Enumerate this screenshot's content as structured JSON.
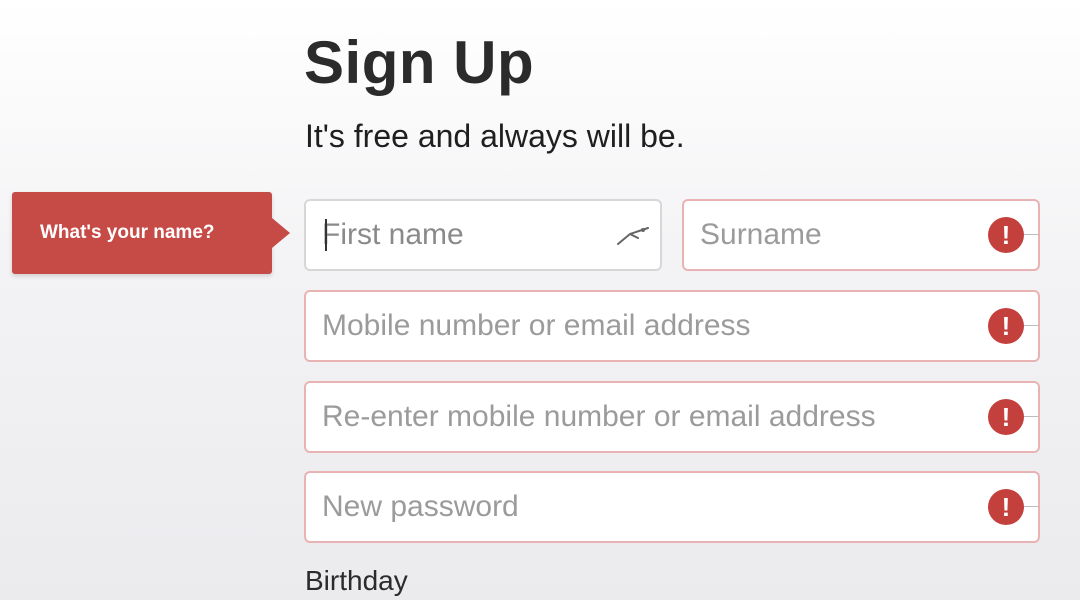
{
  "header": {
    "title": "Sign Up",
    "subtitle": "It's free and always will be."
  },
  "tooltip": {
    "text": "What's your name?"
  },
  "form": {
    "first_name": {
      "placeholder": "First name",
      "value": ""
    },
    "surname": {
      "placeholder": "Surname",
      "value": ""
    },
    "contact": {
      "placeholder": "Mobile number or email address",
      "value": ""
    },
    "contact_confirm": {
      "placeholder": "Re-enter mobile number or email address",
      "value": ""
    },
    "password": {
      "placeholder": "New password",
      "value": ""
    },
    "error_symbol": "!",
    "birthday_label": "Birthday"
  },
  "colors": {
    "error": "#c4403c",
    "tooltip_bg": "#c64b47",
    "error_border": "#e9b3b3"
  },
  "icons": [
    "autofill-icon",
    "error-icon"
  ]
}
